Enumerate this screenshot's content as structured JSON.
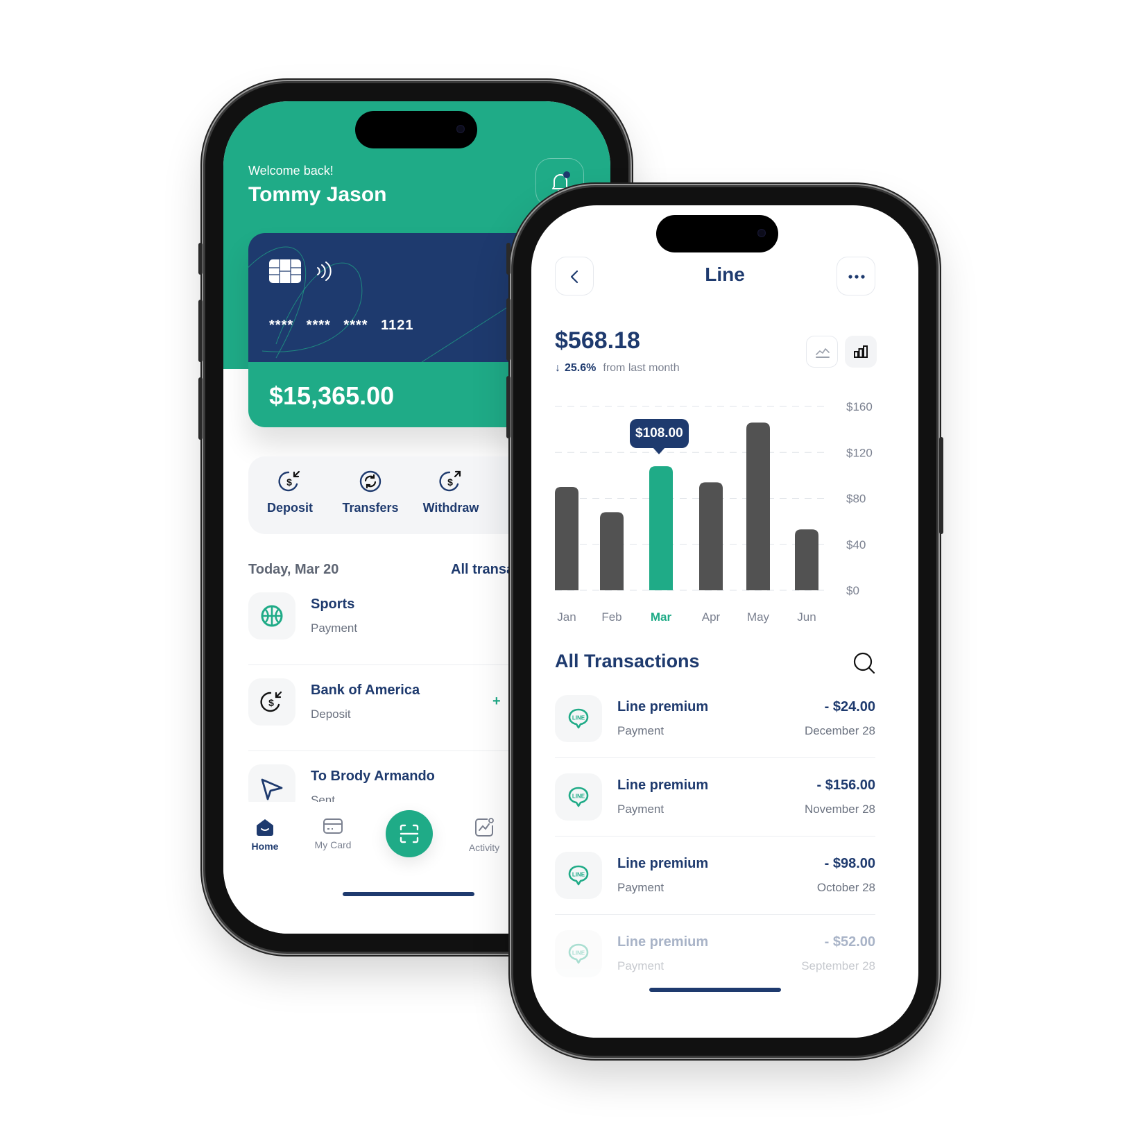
{
  "left_phone": {
    "header": {
      "greeting": "Welcome back!",
      "user_name": "Tommy Jason",
      "notification_icon": "bell-icon"
    },
    "card": {
      "masked_groups": [
        "****",
        "****",
        "****"
      ],
      "last_four": "1121",
      "balance": "$15,365.00",
      "chip_icon": "card-chip-icon",
      "contactless_icon": "contactless-icon"
    },
    "quick_actions": [
      {
        "label": "Deposit",
        "icon": "dollar-in-icon"
      },
      {
        "label": "Transfers",
        "icon": "refresh-icon"
      },
      {
        "label": "Withdraw",
        "icon": "dollar-out-icon"
      }
    ],
    "transactions_section": {
      "date_label": "Today, Mar 20",
      "link_label": "All transactions"
    },
    "transactions": [
      {
        "title": "Sports",
        "subtitle": "Payment",
        "icon": "basketball-icon",
        "amount": ""
      },
      {
        "title": "Bank of America",
        "subtitle": "Deposit",
        "icon": "dollar-in-icon",
        "amount": "+"
      },
      {
        "title": "To Brody Armando",
        "subtitle": "Sent",
        "icon": "send-icon",
        "amount": ""
      }
    ],
    "tab_bar": {
      "tabs": [
        {
          "label": "Home",
          "icon": "home-icon",
          "active": true
        },
        {
          "label": "My Card",
          "icon": "card-icon",
          "active": false
        },
        {
          "label": "Activity",
          "icon": "activity-icon",
          "active": false
        }
      ],
      "center_action_icon": "scan-icon"
    }
  },
  "right_phone": {
    "header": {
      "title": "Line",
      "back_icon": "chevron-left-icon",
      "more_icon": "more-horizontal-icon"
    },
    "summary": {
      "total": "$568.18",
      "change_arrow": "↓",
      "change_percent": "25.6%",
      "change_text": "from last month"
    },
    "view_toggles": [
      {
        "name": "line-view",
        "icon": "line-chart-icon",
        "active": false
      },
      {
        "name": "bar-view",
        "icon": "bar-chart-icon",
        "active": true
      }
    ],
    "transactions_title": "All Transactions",
    "search_icon": "search-icon",
    "transactions": [
      {
        "name": "Line premium",
        "type": "Payment",
        "amount": "- $24.00",
        "date": "December 28",
        "faded": false
      },
      {
        "name": "Line premium",
        "type": "Payment",
        "amount": "- $156.00",
        "date": "November 28",
        "faded": false
      },
      {
        "name": "Line premium",
        "type": "Payment",
        "amount": "- $98.00",
        "date": "October 28",
        "faded": false
      },
      {
        "name": "Line premium",
        "type": "Payment",
        "amount": "- $52.00",
        "date": "September 28",
        "faded": true
      }
    ]
  },
  "colors": {
    "brand_green": "#1fab87",
    "brand_navy": "#1e3a6e",
    "bar_default": "#525252",
    "muted_text": "#6b7280"
  },
  "chart_data": {
    "type": "bar",
    "title": "",
    "categories": [
      "Jan",
      "Feb",
      "Mar",
      "Apr",
      "May",
      "Jun"
    ],
    "values": [
      90,
      68,
      108,
      94,
      146,
      53
    ],
    "highlighted_index": 2,
    "highlight_label": "$108.00",
    "yticks": [
      0,
      40,
      80,
      120,
      160
    ],
    "ytick_labels": [
      "$0",
      "$40",
      "$80",
      "$120",
      "$160"
    ],
    "ylim": [
      0,
      160
    ],
    "xlabel": "",
    "ylabel": "",
    "grid": true,
    "y_axis_position": "right"
  }
}
